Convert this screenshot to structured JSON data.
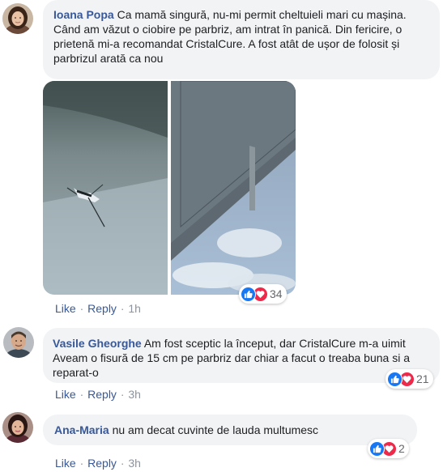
{
  "comments": [
    {
      "author": "Ioana Popa",
      "text": "Ca mamă singură, nu-mi permit cheltuieli mari cu mașina. Când am văzut o ciobire pe parbriz, am intrat în panică. Din fericire, o prietenă mi-a recomandat CristalCure. A fost atât de ușor de folosit și parbrizul arată ca nou",
      "reactions": "34",
      "like": "Like",
      "reply": "Reply",
      "time": "1h"
    },
    {
      "author": "Vasile Gheorghe",
      "text": "Am fost sceptic la început, dar CristalCure m-a uimit Aveam o fisură de 15 cm pe parbriz dar chiar a facut o treaba buna si a reparat-o",
      "reactions": "21",
      "like": "Like",
      "reply": "Reply",
      "time": "3h"
    },
    {
      "author": "Ana-Maria",
      "text": "nu am decat cuvinte de lauda multumesc",
      "reactions": "2",
      "like": "Like",
      "reply": "Reply",
      "time": "3h"
    }
  ],
  "icons": {
    "like": "thumbs-up-icon",
    "love": "heart-icon"
  },
  "colors": {
    "author": "#385898",
    "like": "#1878f3",
    "love": "#f0284a",
    "bubble": "#f2f3f5",
    "meta": "#8d949e"
  }
}
